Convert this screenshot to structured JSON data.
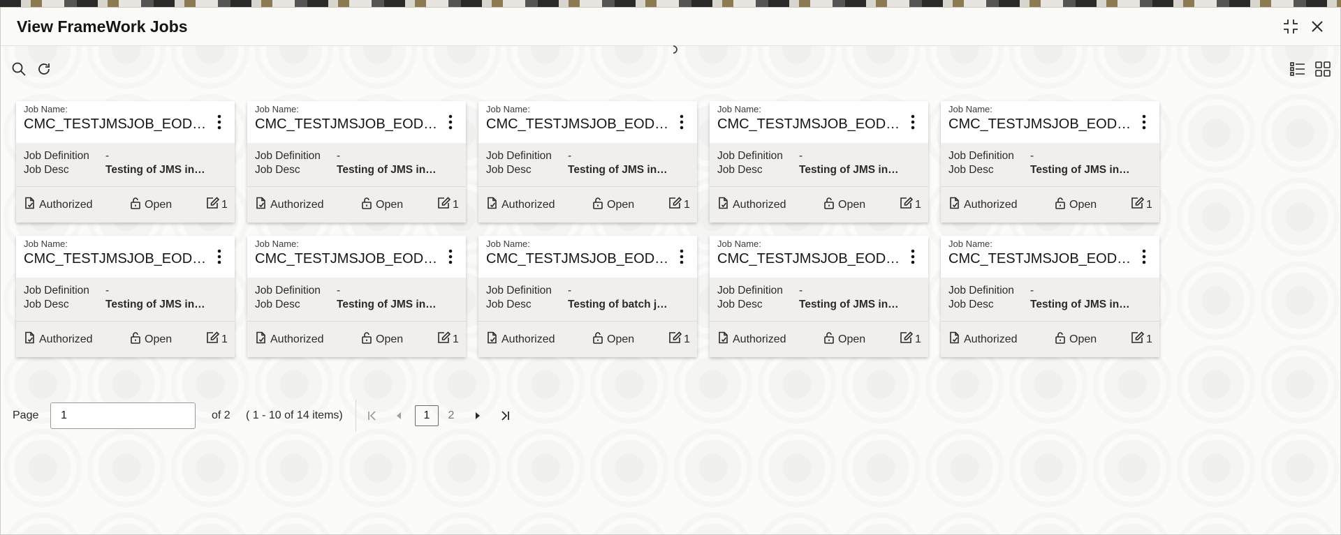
{
  "dialog": {
    "title": "View FrameWork Jobs"
  },
  "cards": [
    {
      "job_name_label": "Job Name:",
      "job_name": "CMC_TESTJMSJOB_EOD_…",
      "def_label": "Job Definition",
      "def_value": "-",
      "desc_label": "Job Desc",
      "desc_value": "Testing of JMS in…",
      "status": "Authorized",
      "lock": "Open",
      "mods": "1"
    },
    {
      "job_name_label": "Job Name:",
      "job_name": "CMC_TESTJMSJOB_EOD_…",
      "def_label": "Job Definition",
      "def_value": "-",
      "desc_label": "Job Desc",
      "desc_value": "Testing of JMS in…",
      "status": "Authorized",
      "lock": "Open",
      "mods": "1"
    },
    {
      "job_name_label": "Job Name:",
      "job_name": "CMC_TESTJMSJOB_EOD_…",
      "def_label": "Job Definition",
      "def_value": "-",
      "desc_label": "Job Desc",
      "desc_value": "Testing of JMS in…",
      "status": "Authorized",
      "lock": "Open",
      "mods": "1"
    },
    {
      "job_name_label": "Job Name:",
      "job_name": "CMC_TESTJMSJOB_EOD_…",
      "def_label": "Job Definition",
      "def_value": "-",
      "desc_label": "Job Desc",
      "desc_value": "Testing of JMS in…",
      "status": "Authorized",
      "lock": "Open",
      "mods": "1"
    },
    {
      "job_name_label": "Job Name:",
      "job_name": "CMC_TESTJMSJOB_EOD_…",
      "def_label": "Job Definition",
      "def_value": "-",
      "desc_label": "Job Desc",
      "desc_value": "Testing of JMS in…",
      "status": "Authorized",
      "lock": "Open",
      "mods": "1"
    },
    {
      "job_name_label": "Job Name:",
      "job_name": "CMC_TESTJMSJOB_EOD_…",
      "def_label": "Job Definition",
      "def_value": "-",
      "desc_label": "Job Desc",
      "desc_value": "Testing of JMS in…",
      "status": "Authorized",
      "lock": "Open",
      "mods": "1"
    },
    {
      "job_name_label": "Job Name:",
      "job_name": "CMC_TESTJMSJOB_EOD_…",
      "def_label": "Job Definition",
      "def_value": "-",
      "desc_label": "Job Desc",
      "desc_value": "Testing of JMS in…",
      "status": "Authorized",
      "lock": "Open",
      "mods": "1"
    },
    {
      "job_name_label": "Job Name:",
      "job_name": "CMC_TESTJMSJOB_EOD_…",
      "def_label": "Job Definition",
      "def_value": "-",
      "desc_label": "Job Desc",
      "desc_value": "Testing of batch job…",
      "status": "Authorized",
      "lock": "Open",
      "mods": "1"
    },
    {
      "job_name_label": "Job Name:",
      "job_name": "CMC_TESTJMSJOB_EOD_…",
      "def_label": "Job Definition",
      "def_value": "-",
      "desc_label": "Job Desc",
      "desc_value": "Testing of JMS in…",
      "status": "Authorized",
      "lock": "Open",
      "mods": "1"
    },
    {
      "job_name_label": "Job Name:",
      "job_name": "CMC_TESTJMSJOB_EOD_…",
      "def_label": "Job Definition",
      "def_value": "-",
      "desc_label": "Job Desc",
      "desc_value": "Testing of JMS in…",
      "status": "Authorized",
      "lock": "Open",
      "mods": "1"
    }
  ],
  "pagination": {
    "page_label": "Page",
    "current_page": "1",
    "of_label": "of 2",
    "range_label": "( 1 - 10 of 14 items)",
    "pages": [
      "1",
      "2"
    ]
  },
  "icons": {
    "search": "search-icon",
    "refresh": "refresh-icon",
    "list_view": "list-view-icon",
    "grid_view": "grid-view-icon",
    "collapse": "collapse-icon",
    "close": "close-icon"
  },
  "colors": {
    "text": "#161513",
    "card_body": "#f0efee",
    "background": "#fbfbfa"
  }
}
